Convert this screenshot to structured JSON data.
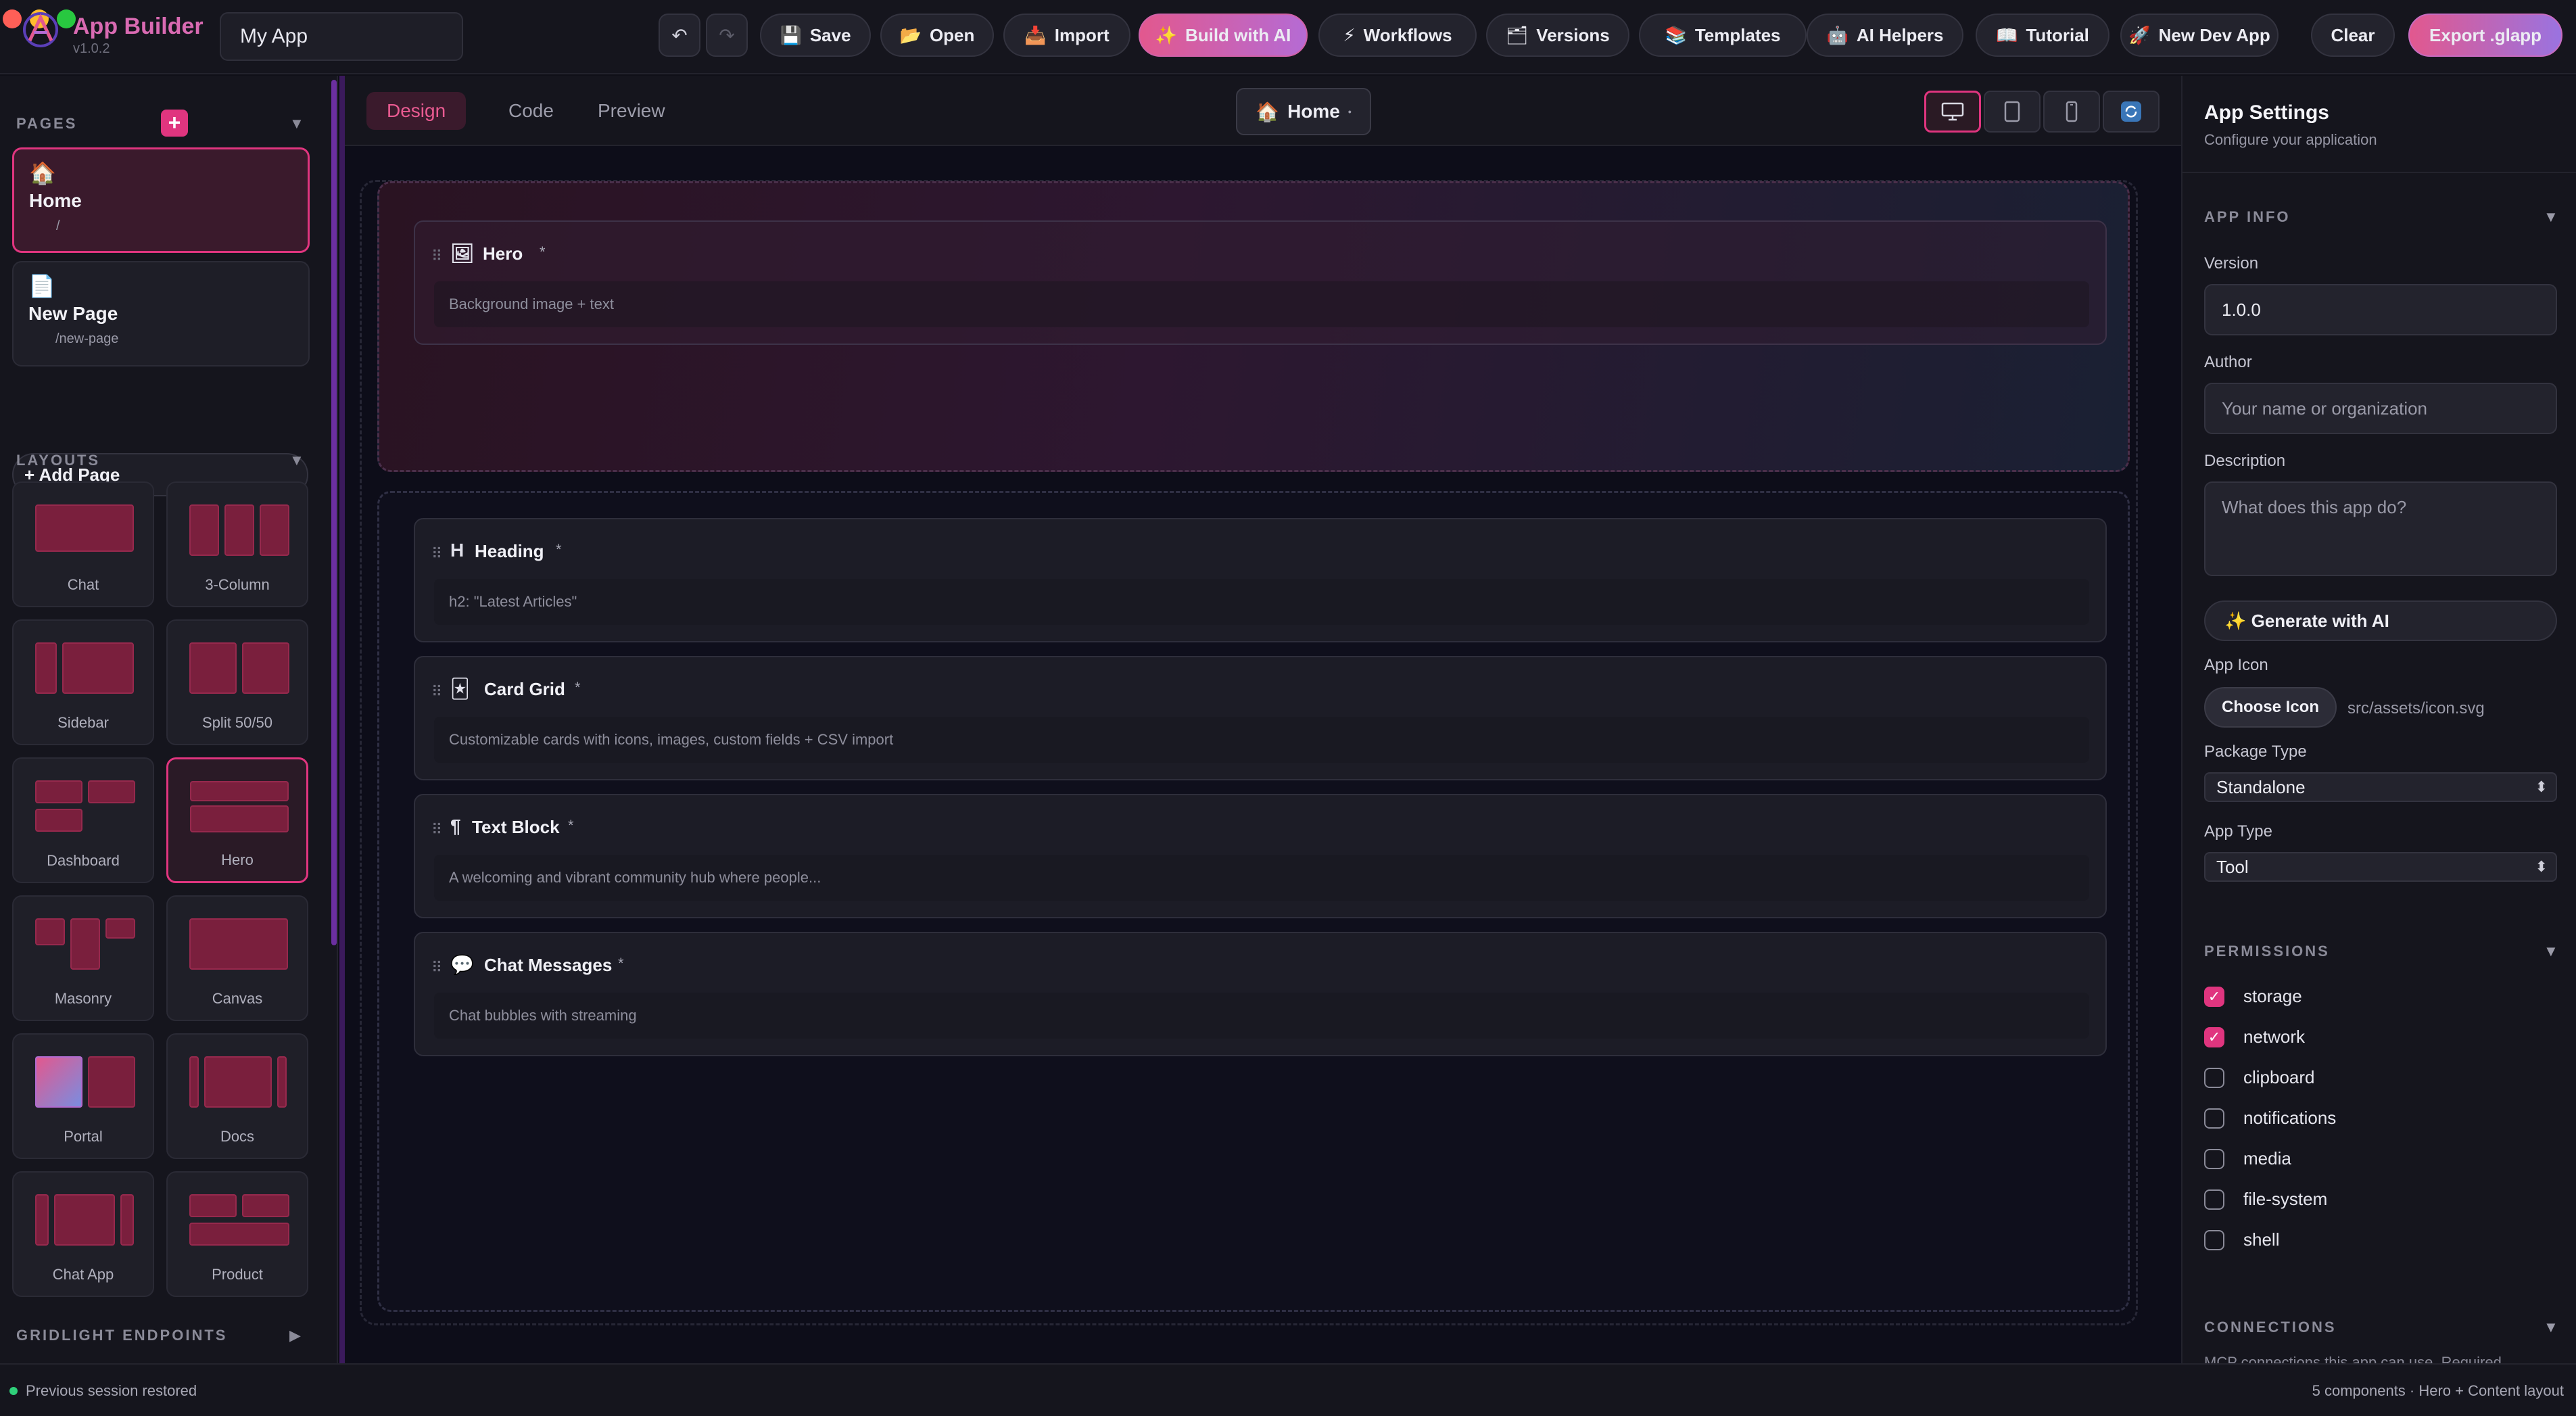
{
  "app": {
    "brand": "App Builder",
    "version": "v1.0.2",
    "app_name": "My App"
  },
  "toolbar": {
    "undo_icon": "undo-icon",
    "redo_icon": "redo-icon",
    "buttons": [
      {
        "icon": "💾",
        "label": "Save"
      },
      {
        "icon": "📂",
        "label": "Open"
      },
      {
        "icon": "📥",
        "label": "Import"
      },
      {
        "icon": "✨",
        "label": "Build with AI"
      },
      {
        "icon": "⚡",
        "label": "Workflows"
      },
      {
        "icon": "🗂",
        "label": "Versions"
      },
      {
        "icon": "📚",
        "label": "Templates"
      },
      {
        "icon": "🤖",
        "label": "AI Helpers"
      },
      {
        "icon": "📖",
        "label": "Tutorial"
      },
      {
        "icon": "🚀",
        "label": "New Dev App"
      },
      {
        "icon": "",
        "label": "Clear"
      },
      {
        "icon": "",
        "label": "Export .glapp"
      }
    ]
  },
  "sidebar": {
    "pages_heading": "PAGES",
    "pages": [
      {
        "icon": "🏠",
        "name": "Home",
        "path": "/"
      },
      {
        "icon": "📄",
        "name": "New Page",
        "path": "/new-page"
      }
    ],
    "add_page_label": "+ Add Page",
    "layouts_heading": "LAYOUTS",
    "layouts": [
      {
        "label": "Chat"
      },
      {
        "label": "3-Column"
      },
      {
        "label": "Sidebar"
      },
      {
        "label": "Split 50/50"
      },
      {
        "label": "Dashboard"
      },
      {
        "label": "Hero"
      },
      {
        "label": "Masonry"
      },
      {
        "label": "Canvas"
      },
      {
        "label": "Portal"
      },
      {
        "label": "Docs"
      },
      {
        "label": "Chat App"
      },
      {
        "label": "Product"
      }
    ],
    "gridlight_heading": "GRIDLIGHT ENDPOINTS"
  },
  "center": {
    "tabs": [
      {
        "label": "Design"
      },
      {
        "label": "Code"
      },
      {
        "label": "Preview"
      }
    ],
    "page_selector": {
      "icon": "🏠",
      "label": "Home",
      "marker": "•"
    },
    "components": [
      {
        "icon": "🖼",
        "title": "Hero",
        "marker": "*",
        "desc": "Background image + text"
      },
      {
        "icon": "H",
        "title": "Heading",
        "marker": "*",
        "desc": "h2: \"Latest Articles\""
      },
      {
        "icon": "🃏",
        "title": "Card Grid",
        "marker": "*",
        "desc": "Customizable cards with icons, images, custom fields + CSV import"
      },
      {
        "icon": "¶",
        "title": "Text Block",
        "marker": "*",
        "desc": "A welcoming and vibrant community hub where people..."
      },
      {
        "icon": "💬",
        "title": "Chat Messages",
        "marker": "*",
        "desc": "Chat bubbles with streaming"
      }
    ]
  },
  "settings": {
    "title": "App Settings",
    "subtitle": "Configure your application",
    "app_info_heading": "APP INFO",
    "version_label": "Version",
    "version_value": "1.0.0",
    "author_label": "Author",
    "author_placeholder": "Your name or organization",
    "description_label": "Description",
    "description_placeholder": "What does this app do?",
    "generate_label": "✨  Generate with AI",
    "app_icon_label": "App Icon",
    "choose_icon_label": "Choose Icon",
    "icon_path": "src/assets/icon.svg",
    "package_type_label": "Package Type",
    "package_type_value": "Standalone",
    "app_type_label": "App Type",
    "app_type_value": "Tool",
    "permissions_heading": "PERMISSIONS",
    "permissions": [
      {
        "name": "storage",
        "checked": true
      },
      {
        "name": "network",
        "checked": true
      },
      {
        "name": "clipboard",
        "checked": false
      },
      {
        "name": "notifications",
        "checked": false
      },
      {
        "name": "media",
        "checked": false
      },
      {
        "name": "file-system",
        "checked": false
      },
      {
        "name": "shell",
        "checked": false
      }
    ],
    "connections_heading": "CONNECTIONS",
    "connections_text": "MCP connections this app can use. Required..."
  },
  "status": {
    "left": "Previous session restored",
    "right": "5 components · Hero + Content layout"
  },
  "colors": {
    "accent": "#e0357f",
    "background": "#0f0f17",
    "panel": "#15151d",
    "status_ok": "#2fd07a"
  }
}
